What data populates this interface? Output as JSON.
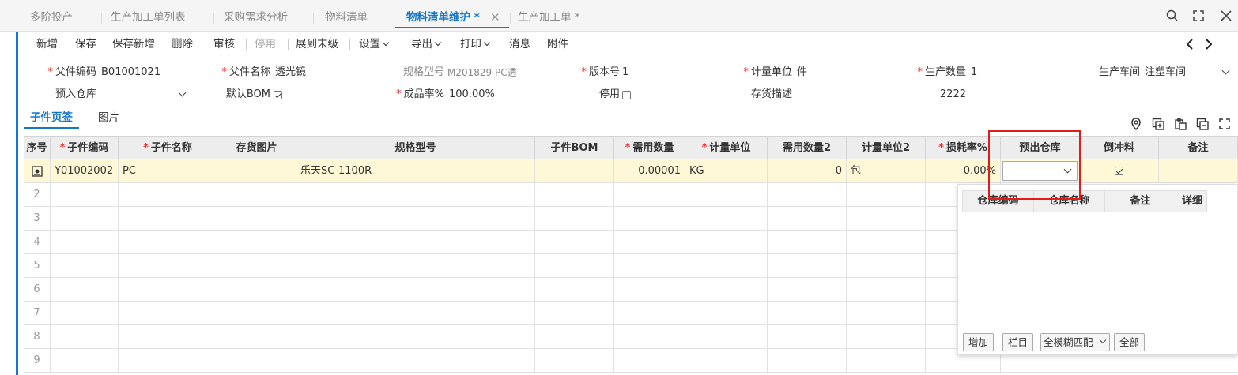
{
  "tabs": [
    {
      "label": "多阶投产"
    },
    {
      "label": "生产加工单列表"
    },
    {
      "label": "采购需求分析"
    },
    {
      "label": "物料清单"
    },
    {
      "label": "物料清单维护 *"
    },
    {
      "label": "生产加工单 *"
    }
  ],
  "toolbar": {
    "items": [
      "新增",
      "保存",
      "保存新增",
      "删除",
      "审核",
      "停用",
      "展到末级",
      "设置",
      "导出",
      "打印",
      "消息",
      "附件"
    ]
  },
  "form": {
    "parent_code_label": "父件编码",
    "parent_code": "B01001021",
    "parent_name_label": "父件名称",
    "parent_name": "透光镜",
    "spec_label": "规格型号",
    "spec": "M201829  PC透",
    "version_label": "版本号",
    "version": "1",
    "unit_label": "计量单位",
    "unit": "件",
    "qty_label": "生产数量",
    "qty": "1",
    "workshop_label": "生产车间",
    "workshop": "注塑车间",
    "in_wh_label": "预入仓库",
    "in_wh": "",
    "default_bom_label": "默认BOM",
    "default_bom": true,
    "yield_label": "成品率%",
    "yield": "100.00%",
    "disabled_label": "停用",
    "disabled": false,
    "inv_desc_label": "存货描述",
    "inv_desc": "",
    "extra_label": "2222",
    "extra": ""
  },
  "subtabs": [
    "子件页签",
    "图片"
  ],
  "table": {
    "headers": [
      "序号",
      "子件编码",
      "子件名称",
      "存货图片",
      "规格型号",
      "子件BOM",
      "需用数量",
      "计量单位",
      "需用数量2",
      "计量单位2",
      "损耗率%",
      "预出仓库",
      "倒冲料",
      "备注"
    ],
    "rows": [
      {
        "code": "Y01002002",
        "name": "PC",
        "image": "",
        "spec": "乐天SC-1100R",
        "bom": "",
        "qty": "0.00001",
        "unit": "KG",
        "qty2": "0",
        "unit2": "包",
        "loss": "0.00%",
        "out_wh": "",
        "backflush": true,
        "note": ""
      }
    ],
    "row_numbers": [
      "2",
      "3",
      "4",
      "5",
      "6",
      "7",
      "8",
      "9"
    ]
  },
  "popup": {
    "headers": [
      "仓库编码",
      "仓库名称",
      "备注",
      "详细"
    ],
    "buttons": {
      "add": "增加",
      "columns": "栏目",
      "match": "全模糊匹配",
      "all": "全部"
    }
  },
  "colors": {
    "accent": "#1677c8",
    "highlight_row": "#fff8d6",
    "annotation": "#e21b1b"
  }
}
